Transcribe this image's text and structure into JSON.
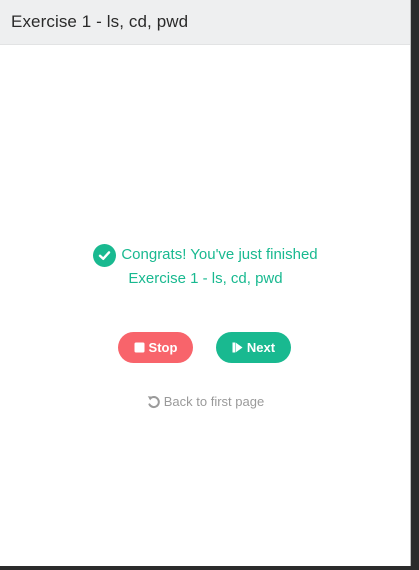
{
  "header": {
    "title": "Exercise 1 - ls, cd, pwd"
  },
  "result": {
    "line1": "Congrats! You've just finished",
    "line2": "Exercise 1 - ls, cd, pwd",
    "icon": "check-circle-icon"
  },
  "actions": {
    "stop_label": "Stop",
    "stop_icon": "stop-icon",
    "next_label": "Next",
    "next_icon": "step-forward-icon",
    "back_label": "Back to first page",
    "back_icon": "undo-icon"
  },
  "colors": {
    "success": "#19b990",
    "danger": "#f8646b",
    "muted": "#9a9a9a",
    "header_bg": "#eeeff0"
  }
}
